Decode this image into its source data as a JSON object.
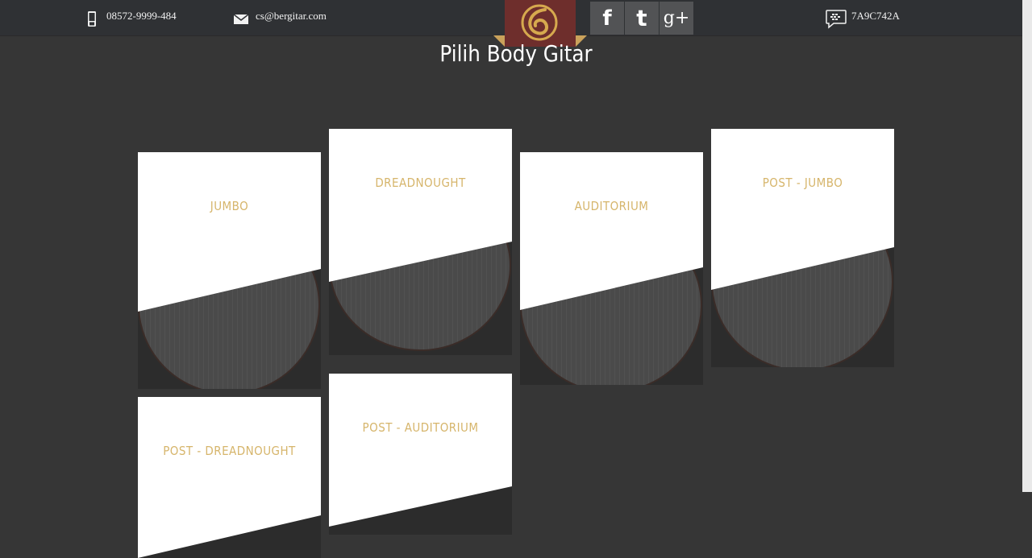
{
  "header": {
    "phone": "08572-9999-484",
    "email": "cs@bergitar.com",
    "bbm_pin": "7A9C742A",
    "social": [
      {
        "name": "facebook",
        "glyph": "f"
      },
      {
        "name": "twitter",
        "glyph": "t"
      },
      {
        "name": "google-plus",
        "glyph": "g+"
      }
    ]
  },
  "page": {
    "title": "Pilih Body Gitar"
  },
  "cards": [
    {
      "label": "JUMBO"
    },
    {
      "label": "DREADNOUGHT"
    },
    {
      "label": "AUDITORIUM"
    },
    {
      "label": "POST - JUMBO"
    },
    {
      "label": "POST - DREADNOUGHT"
    },
    {
      "label": "POST - AUDITORIUM"
    }
  ],
  "colors": {
    "background": "#363636",
    "topbar": "#2f3134",
    "accent_gold": "#d6b56b",
    "logo_maroon": "#6e2e2c"
  }
}
